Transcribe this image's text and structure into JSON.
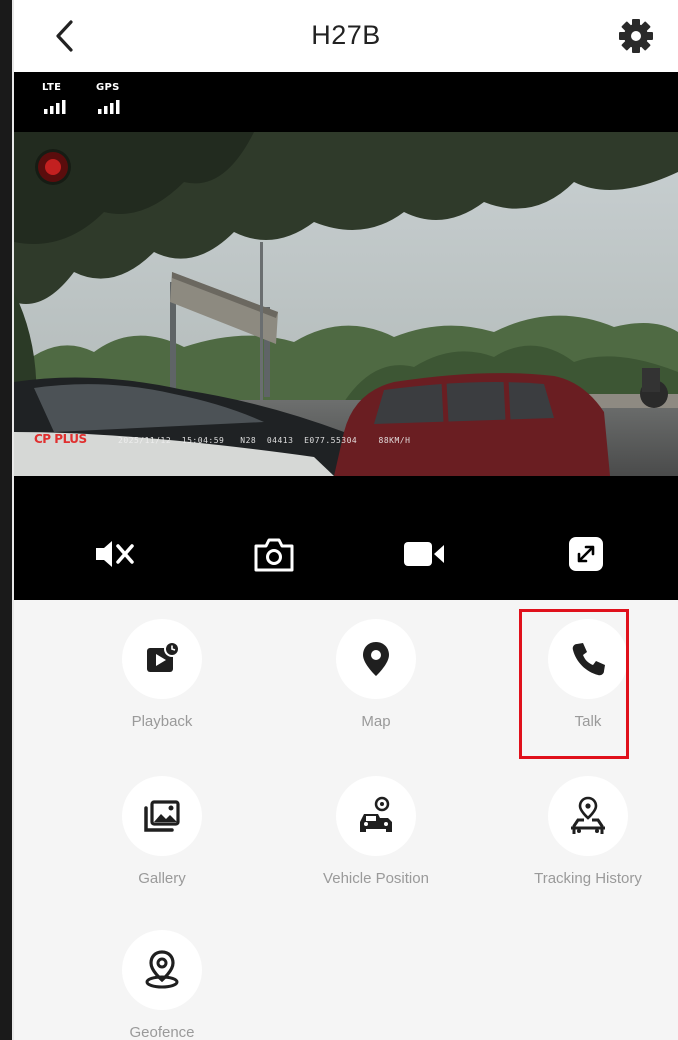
{
  "header": {
    "title": "H27B",
    "back_icon": "chevron-left-icon",
    "settings_icon": "gear-icon"
  },
  "status_bar": {
    "signals": [
      {
        "label": "LTE",
        "icon": "signal-bars-icon"
      },
      {
        "label": "GPS",
        "icon": "signal-bars-icon"
      }
    ]
  },
  "video": {
    "brand_overlay": "CP PLUS",
    "timestamp_overlay": "2025/11/12  15:04:59   N28  04413  E077.55304    88KM/H",
    "recording_indicator": "rec-dot-icon"
  },
  "controls": [
    {
      "icon": "mute-icon"
    },
    {
      "icon": "camera-icon"
    },
    {
      "icon": "video-record-icon"
    },
    {
      "icon": "fullscreen-icon"
    }
  ],
  "features": [
    {
      "label": "Playback",
      "icon": "playback-icon"
    },
    {
      "label": "Map",
      "icon": "map-pin-icon"
    },
    {
      "label": "Talk",
      "icon": "phone-icon",
      "highlighted": true
    },
    {
      "label": "Gallery",
      "icon": "gallery-icon"
    },
    {
      "label": "Vehicle Position",
      "icon": "vehicle-position-icon"
    },
    {
      "label": "Tracking History",
      "icon": "tracking-history-icon"
    },
    {
      "label": "Geofence",
      "icon": "geofence-icon"
    }
  ],
  "colors": {
    "highlight": "#e0101b",
    "label_gray": "#9a9a9a",
    "background": "#f5f5f5"
  }
}
